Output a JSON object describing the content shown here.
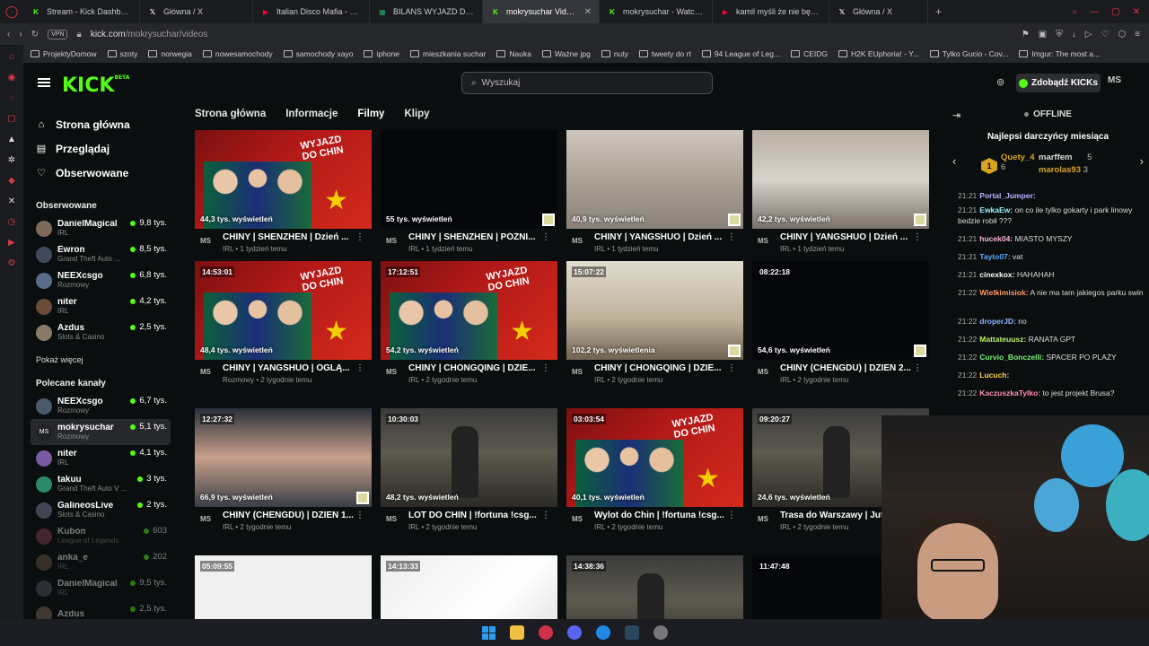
{
  "browser": {
    "tabs": [
      {
        "title": "Stream - Kick Dashboard",
        "icon": "kick-icon",
        "color": "#53fc18"
      },
      {
        "title": "Główna / X",
        "icon": "x-icon",
        "color": "#ffffff"
      },
      {
        "title": "Italian Disco Mafia - Buo",
        "icon": "youtube-icon",
        "color": "#ff0033"
      },
      {
        "title": "BILANS WYJAZD DELEG",
        "icon": "sheets-icon",
        "color": "#21a366"
      },
      {
        "title": "mokrysuchar Videos",
        "icon": "kick-icon",
        "color": "#53fc18",
        "active": true
      },
      {
        "title": "mokrysuchar - Watch th",
        "icon": "kick-icon",
        "color": "#53fc18"
      },
      {
        "title": "kamil myśli że nie będą p",
        "icon": "youtube-icon",
        "color": "#ff0033"
      },
      {
        "title": "Główna / X",
        "icon": "x-icon",
        "color": "#ffffff"
      }
    ],
    "vpn_label": "VPN",
    "url_host": "kick.com",
    "url_path": "/mokrysuchar/videos",
    "bookmarks": [
      "ProjektyDomow",
      "szoty",
      "norwegia",
      "nowesamochody",
      "samochody xayo",
      "iphone",
      "mieszkania suchar",
      "Nauka",
      "Ważne jpg",
      "nuty",
      "tweety do rt",
      "94 League of Leg...",
      "CEIDG",
      "H2K EUphoria! - Y...",
      "Tylko Gucio - Cov...",
      "Imgur: The most a..."
    ]
  },
  "site": {
    "logo": "KICK",
    "logo_sup": "BETA",
    "search_placeholder": "Wyszukaj",
    "kicks_button": "Zdobądź KICKs",
    "user_initials": "MS"
  },
  "sidebar": {
    "nav": [
      {
        "label": "Strona główna",
        "icon": "home-icon"
      },
      {
        "label": "Przeglądaj",
        "icon": "browse-icon"
      },
      {
        "label": "Obserwowane",
        "icon": "heart-icon"
      }
    ],
    "followed_title": "Obserwowane",
    "followed": [
      {
        "name": "DanielMagical",
        "category": "IRL",
        "viewers": "9,8 tys."
      },
      {
        "name": "Ewron",
        "category": "Grand Theft Auto ...",
        "viewers": "8,5 tys."
      },
      {
        "name": "NEEXcsgo",
        "category": "Rozmowy",
        "viewers": "6,8 tys."
      },
      {
        "name": "niter",
        "category": "IRL",
        "viewers": "4,2 tys."
      },
      {
        "name": "Azdus",
        "category": "Slots & Casino",
        "viewers": "2,5 tys."
      }
    ],
    "show_more": "Pokaż więcej",
    "recommended_title": "Polecane kanały",
    "recommended": [
      {
        "name": "NEEXcsgo",
        "category": "Rozmowy",
        "viewers": "6,7 tys."
      },
      {
        "name": "mokrysuchar",
        "category": "Rozmowy",
        "viewers": "5,1 tys."
      },
      {
        "name": "niter",
        "category": "IRL",
        "viewers": "4,1 tys."
      },
      {
        "name": "takuu",
        "category": "Grand Theft Auto V ...",
        "viewers": "3 tys."
      },
      {
        "name": "GalineosLive",
        "category": "Slots & Casino",
        "viewers": "2 tys."
      },
      {
        "name": "Kubon",
        "category": "League of Legends",
        "viewers": "603"
      },
      {
        "name": "anka_e",
        "category": "IRL",
        "viewers": "202"
      },
      {
        "name": "DanielMagical",
        "category": "IRL",
        "viewers": "9,5 tys."
      },
      {
        "name": "Azdus",
        "category": "",
        "viewers": "2,5 tys."
      }
    ]
  },
  "profile_tabs": [
    "Strona główna",
    "Informacje",
    "Filmy",
    "Klipy"
  ],
  "videos": [
    {
      "duration": "",
      "views": "44,3 tys. wyświetleń",
      "title": "CHINY | SHENZHEN | Dzień ...",
      "category": "IRL",
      "age": "1 tydzień temu",
      "style": "th-china"
    },
    {
      "duration": "",
      "views": "55 tys. wyświetleń",
      "title": "CHINY | SHENZHEN | PÓŹNI...",
      "category": "IRL",
      "age": "1 tydzień temu",
      "style": "th-dark"
    },
    {
      "duration": "",
      "views": "40,9 tys. wyświetleń",
      "title": "CHINY | YANGSHUO | Dzień ...",
      "category": "IRL",
      "age": "1 tydzień temu",
      "style": "th-room"
    },
    {
      "duration": "",
      "views": "42,2 tys. wyświetleń",
      "title": "CHINY | YANGSHUO | Dzień ...",
      "category": "IRL",
      "age": "1 tydzień temu",
      "style": "th-room2"
    },
    {
      "duration": "14:53:01",
      "views": "48,4 tys. wyświetleń",
      "title": "CHINY | YANGSHUO | OGLĄ...",
      "category": "Rozmowy",
      "age": "2 tygodnie temu",
      "style": "th-china"
    },
    {
      "duration": "17:12:51",
      "views": "54,2 tys. wyświetleń",
      "title": "CHINY | CHONGQING | DZIE...",
      "category": "IRL",
      "age": "2 tygodnie temu",
      "style": "th-china"
    },
    {
      "duration": "15:07:22",
      "views": "102,2 tys. wyświetlenia",
      "title": "CHINY | CHONGQING | DZIE...",
      "category": "IRL",
      "age": "2 tygodnie temu",
      "style": "th-desk"
    },
    {
      "duration": "08:22:18",
      "views": "54,6 tys. wyświetleń",
      "title": "CHINY (CHENGDU) | DZIEŃ 2...",
      "category": "IRL",
      "age": "2 tygodnie temu",
      "style": "th-dark"
    },
    {
      "duration": "12:27:32",
      "views": "66,9 tys. wyświetleń",
      "title": "CHINY (CHENGDU) | DZIEŃ 1...",
      "category": "IRL",
      "age": "2 tygodnie temu",
      "style": "th-screen"
    },
    {
      "duration": "10:30:03",
      "views": "48,2 tys. wyświetleń",
      "title": "LOT DO CHIN | !fortuna !csg...",
      "category": "IRL",
      "age": "2 tygodnie temu",
      "style": "th-anime"
    },
    {
      "duration": "03:03:54",
      "views": "40,1 tys. wyświetleń",
      "title": "Wylot do Chin | !fortuna !csg...",
      "category": "IRL",
      "age": "2 tygodnie temu",
      "style": "th-china"
    },
    {
      "duration": "09:20:27",
      "views": "24,6 tys. wyświetleń",
      "title": "Trasa do Warszawy | Jutr...",
      "category": "IRL",
      "age": "2 tygodnie temu",
      "style": "th-anime"
    },
    {
      "duration": "05:09:55",
      "views": "",
      "title": "",
      "category": "",
      "age": "",
      "style": "th-sketch"
    },
    {
      "duration": "14:13:33",
      "views": "",
      "title": "",
      "category": "",
      "age": "",
      "style": "th-sketch2"
    },
    {
      "duration": "14:38:36",
      "views": "",
      "title": "",
      "category": "",
      "age": "",
      "style": "th-anime"
    },
    {
      "duration": "11:47:48",
      "views": "",
      "title": "",
      "category": "",
      "age": "",
      "style": "th-dark"
    }
  ],
  "chat": {
    "status": "OFFLINE",
    "donors_title": "Najlepsi darczyńcy miesiąca",
    "donors": [
      {
        "name": "Quety_4",
        "value": "6"
      },
      {
        "name": "marffem",
        "value": "5"
      },
      {
        "name": "marolas93",
        "value": "3"
      }
    ],
    "messages": [
      {
        "time": "21:21",
        "user": "Portal_Jumper:",
        "text": "",
        "color": "#b6b6ff"
      },
      {
        "time": "21:21",
        "user": "EwkaEw:",
        "text": "on co ile tylko gokarty i park linowy bedzie robił ???",
        "color": "#9bf0ff"
      },
      {
        "time": "21:21",
        "user": "hucek04:",
        "text": "MIASTO MYSZY",
        "color": "#ffb3d9"
      },
      {
        "time": "21:21",
        "user": "Tayto07:",
        "text": "vat",
        "color": "#5aa9ff"
      },
      {
        "time": "21:21",
        "user": "cinexkox:",
        "text": "HAHAHAH",
        "color": "#ffffff"
      },
      {
        "time": "21:22",
        "user": "Wielkimisiok:",
        "text": "A nie ma tam jakiegos parku swin",
        "color": "#ff9a6b"
      },
      {
        "time": "21:22",
        "user": "droperJD:",
        "text": "no",
        "color": "#8ab4ff"
      },
      {
        "time": "21:22",
        "user": "Mattateuusz:",
        "text": "RANATA GPT",
        "color": "#b7f26b"
      },
      {
        "time": "21:22",
        "user": "Curvio_Bonczelli:",
        "text": "SPACER PO PLAŻY",
        "color": "#7cf07c"
      },
      {
        "time": "21:22",
        "user": "Lucuch:",
        "text": "",
        "color": "#ffd24a"
      },
      {
        "time": "21:22",
        "user": "KaczuszkaTylko:",
        "text": "to jest projekt Brusa?",
        "color": "#ff8fb0"
      }
    ]
  },
  "colors": {
    "accent": "#53fc18",
    "bg": "#0b0e0f"
  }
}
